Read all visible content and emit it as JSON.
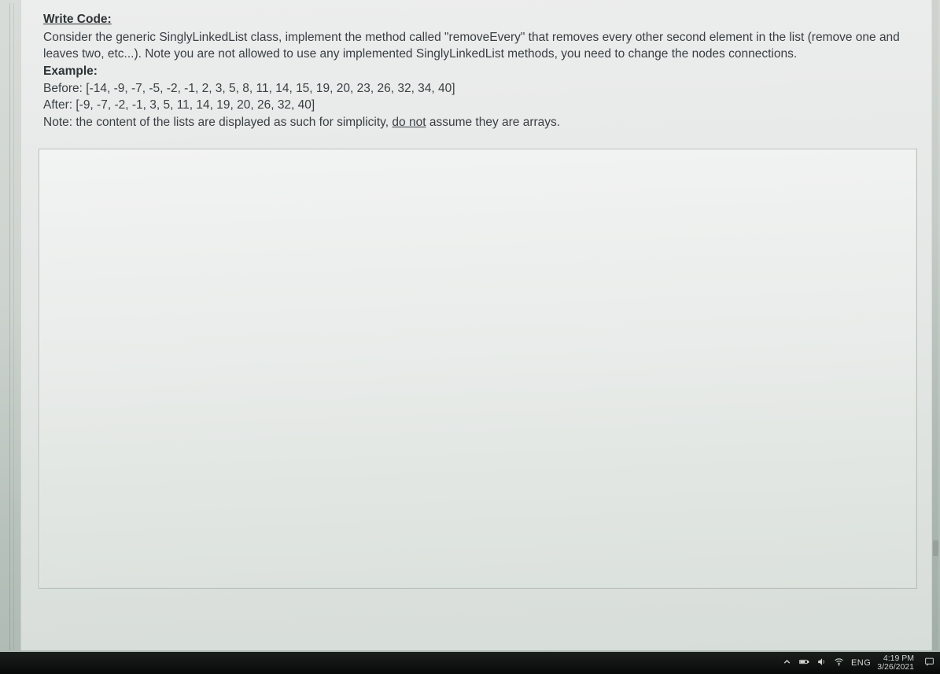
{
  "question": {
    "title": "Write Code:",
    "prompt": "Consider the generic SinglyLinkedList class, implement the method called \"removeEvery\" that removes every other second element in the list (remove one and leaves two, etc...). Note you are not allowed to use any implemented SinglyLinkedList methods, you need to change the nodes connections.",
    "example_label": "Example:",
    "before": "Before: [-14, -9, -7, -5, -2, -1, 2, 3, 5, 8, 11, 14, 15, 19, 20, 23, 26, 32, 34, 40]",
    "after": "After: [-9, -7, -2, -1, 3, 5, 11, 14, 19, 20, 26, 32, 40]",
    "note_prefix": "Note: the content of the lists are displayed as such for simplicity, ",
    "note_underlined": "do not",
    "note_suffix": " assume they are arrays."
  },
  "taskbar": {
    "language": "ENG",
    "time": "4:19 PM",
    "date": "3/26/2021"
  }
}
